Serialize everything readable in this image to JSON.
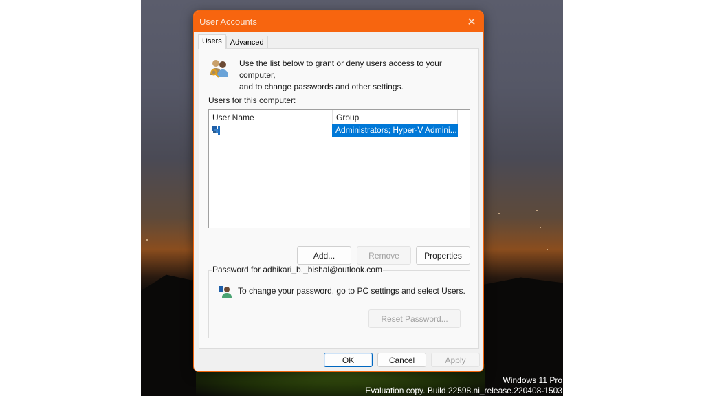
{
  "window": {
    "title": "User Accounts",
    "close_icon": "close-icon",
    "accent_color": "#f7650f"
  },
  "tabs": [
    {
      "label": "Users",
      "active": true
    },
    {
      "label": "Advanced",
      "active": false
    }
  ],
  "intro": {
    "icon": "users-keys-icon",
    "text_line1": "Use the list below to grant or deny users access to your computer,",
    "text_line2": "and to change passwords and other settings."
  },
  "users_list": {
    "label": "Users for this computer:",
    "columns": [
      "User Name",
      "Group"
    ],
    "rows": [
      {
        "user_name": "",
        "user_icon": "user-icon",
        "group": "Administrators; Hyper-V Admini...",
        "selected": true
      }
    ],
    "selection_color": "#0078d7"
  },
  "list_buttons": {
    "add": "Add...",
    "remove": "Remove",
    "properties": "Properties"
  },
  "password_group": {
    "legend": "Password for adhikari_b._bishal@outlook.com",
    "icon": "user-password-icon",
    "text": "To change your password, go to PC settings and select Users.",
    "reset_button": "Reset Password..."
  },
  "footer_buttons": {
    "ok": "OK",
    "cancel": "Cancel",
    "apply": "Apply"
  },
  "desktop_watermark": {
    "line1": "Windows 11 Pro",
    "line2": "Evaluation copy. Build 22598.ni_release.220408-1503"
  }
}
